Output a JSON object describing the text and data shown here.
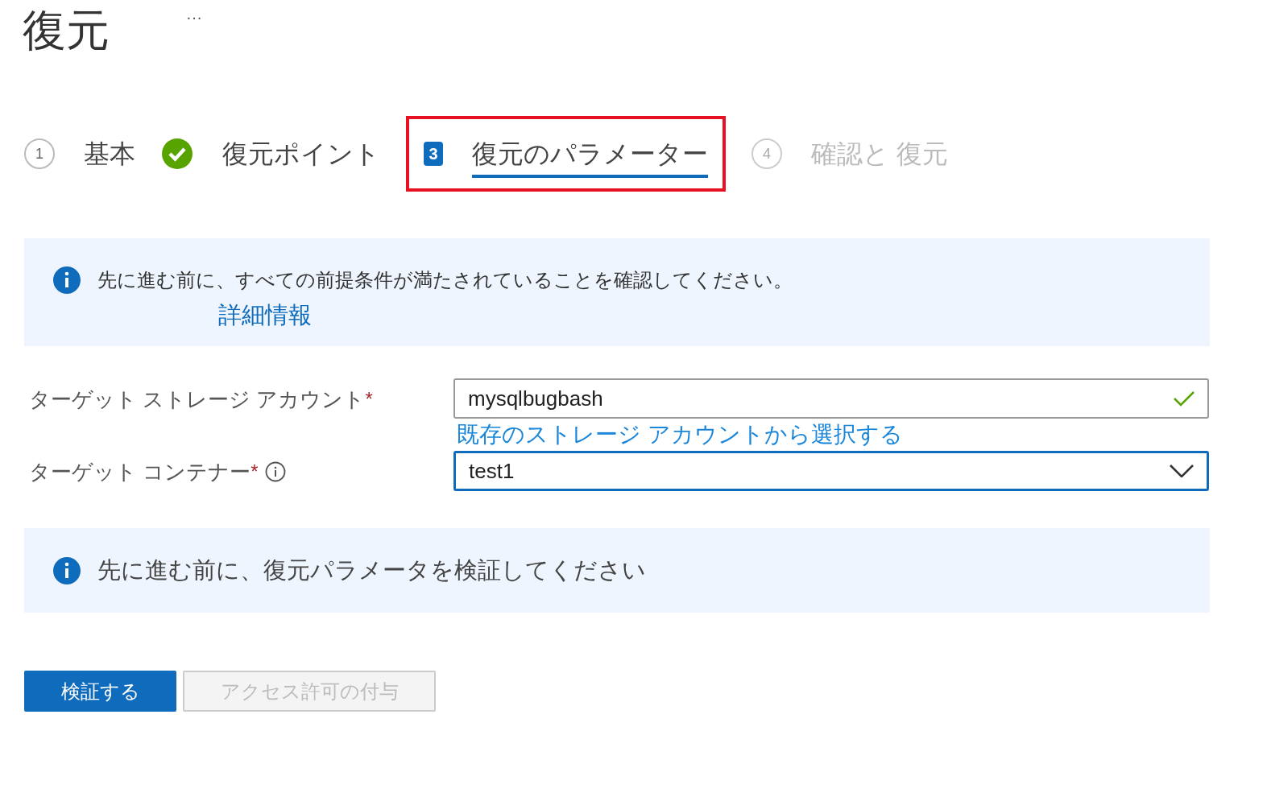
{
  "title": "復元",
  "more": "···",
  "steps": [
    {
      "number": "1",
      "label": "基本",
      "completed": false,
      "disabled": false,
      "selected": false,
      "highlighted": false
    },
    {
      "label": "復元ポイント",
      "completed": true,
      "disabled": false,
      "selected": false,
      "highlighted": false
    },
    {
      "number": "3",
      "label": "復元のパラメーター",
      "completed": false,
      "disabled": false,
      "selected": true,
      "highlighted": true
    },
    {
      "number": "4",
      "label": "確認と 復元",
      "completed": false,
      "disabled": true,
      "selected": false,
      "highlighted": false
    }
  ],
  "prereq_banner": {
    "text": "先に進む前に、すべての前提条件が満たされていることを確認してください。",
    "link": "詳細情報"
  },
  "fields": [
    {
      "kind": "text",
      "label": "ターゲット ストレージ アカウント",
      "required_mark": "*",
      "value": "mysqlbugbash",
      "valid": true,
      "focused": false,
      "link": "既存のストレージ アカウントから選択する"
    },
    {
      "kind": "dropdown",
      "label": "ターゲット コンテナー",
      "required_mark": "*",
      "info": true,
      "value": "test1",
      "valid": false,
      "focused": true
    }
  ],
  "validate_banner": {
    "text": "先に進む前に、復元パラメータを検証してください"
  },
  "buttons": [
    {
      "label": "検証する",
      "kind": "primary",
      "disabled": false
    },
    {
      "label": "アクセス許可の付与",
      "kind": "secondary",
      "disabled": true
    }
  ]
}
